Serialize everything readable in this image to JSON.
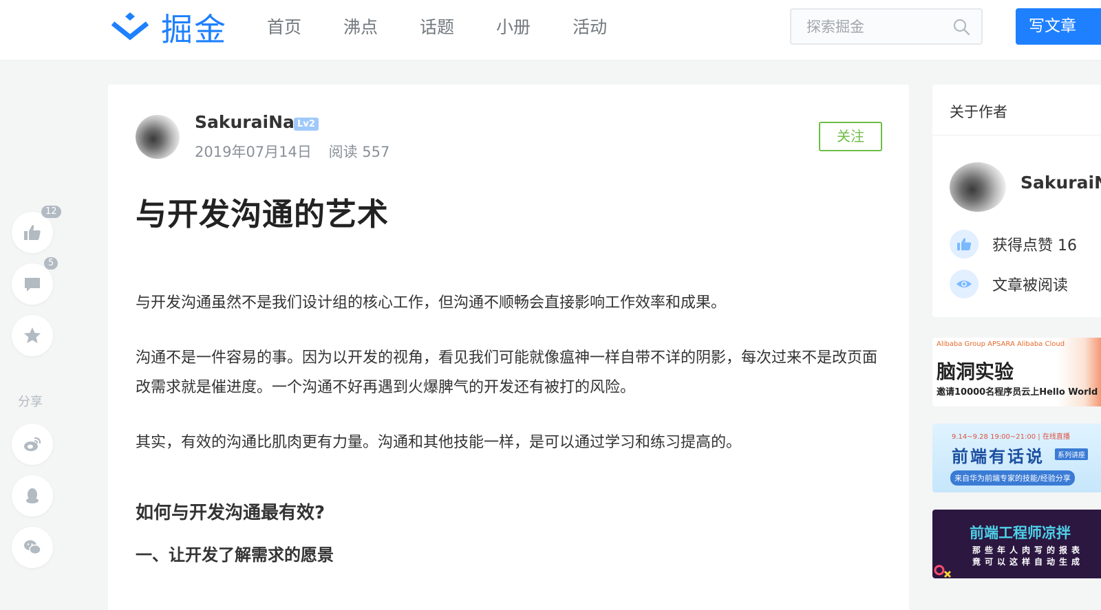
{
  "header": {
    "logo_text": "掘金",
    "nav": [
      "首页",
      "沸点",
      "话题",
      "小册",
      "活动"
    ],
    "search_placeholder": "探索掘金",
    "write_label": "写文章"
  },
  "side_panel": {
    "like_count": "12",
    "comment_count": "5",
    "share_label": "分享"
  },
  "article": {
    "author": "SakuraiNa",
    "level": "Lv2",
    "date": "2019年07月14日",
    "reads": "阅读 557",
    "follow_label": "关注",
    "title": "与开发沟通的艺术",
    "paragraphs": [
      "与开发沟通虽然不是我们设计组的核心工作，但沟通不顺畅会直接影响工作效率和成果。",
      "沟通不是一件容易的事。因为以开发的视角，看见我们可能就像瘟神一样自带不详的阴影，每次过来不是改页面改需求就是催进度。一个沟通不好再遇到火爆脾气的开发还有被打的风险。",
      "其实，有效的沟通比肌肉更有力量。沟通和其他技能一样，是可以通过学习和练习提高的。"
    ],
    "heading": "如何与开发沟通最有效?",
    "subheading": "一、让开发了解需求的愿景"
  },
  "author_card": {
    "title": "关于作者",
    "name": "SakuraiNa",
    "likes_label": "获得点赞 16",
    "reads_label": "文章被阅读"
  },
  "ads": {
    "ad1_tags": "Alibaba Group  APSARA  Alibaba Cloud",
    "ad1_title": "脑洞实验",
    "ad1_sub": "邀请10000名程序员云上Hello World",
    "ad2_date": "9.14~9.28 19:00~21:00 | 在线直播",
    "ad2_title": "前端有话说",
    "ad2_tag": "系列讲座",
    "ad2_sub": "来自华为前端专家的技能/经验分享",
    "ad3_title": "前端工程师凉拌",
    "ad3_line1": "那些年人肉写的报表",
    "ad3_line2": "竟可以这样自动生成"
  },
  "colors": {
    "brand": "#1e80ff",
    "follow": "#6cbd45",
    "badge": "#b2bac2"
  },
  "icons": [
    "juejin-logo-icon",
    "search-icon",
    "thumbs-up-icon",
    "comment-icon",
    "star-icon",
    "weibo-icon",
    "qq-icon",
    "wechat-icon",
    "eye-icon"
  ]
}
